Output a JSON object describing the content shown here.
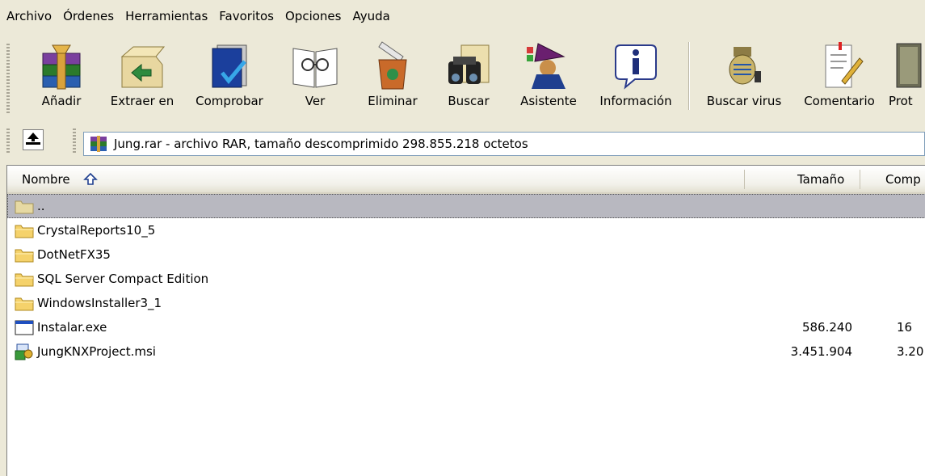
{
  "menu": [
    "Archivo",
    "Órdenes",
    "Herramientas",
    "Favoritos",
    "Opciones",
    "Ayuda"
  ],
  "toolbar": {
    "buttons": [
      {
        "label": "Añadir",
        "icon": "add-archive-icon"
      },
      {
        "label": "Extraer en",
        "icon": "extract-icon"
      },
      {
        "label": "Comprobar",
        "icon": "test-icon"
      },
      {
        "label": "Ver",
        "icon": "view-icon"
      },
      {
        "label": "Eliminar",
        "icon": "delete-icon"
      },
      {
        "label": "Buscar",
        "icon": "find-icon"
      },
      {
        "label": "Asistente",
        "icon": "wizard-icon"
      },
      {
        "label": "Información",
        "icon": "info-icon"
      },
      {
        "label": "Buscar virus",
        "icon": "virus-scan-icon"
      },
      {
        "label": "Comentario",
        "icon": "comment-icon"
      },
      {
        "label": "Prot",
        "icon": "protect-icon"
      }
    ]
  },
  "address": {
    "text": "Jung.rar - archivo RAR, tamaño descomprimido 298.855.218 octetos"
  },
  "columns": {
    "name": "Nombre",
    "size": "Tamaño",
    "packed": "Comp"
  },
  "files": [
    {
      "name": "..",
      "size": "",
      "packed": "",
      "type": "parent-folder",
      "selected": true
    },
    {
      "name": "CrystalReports10_5",
      "size": "",
      "packed": "",
      "type": "folder"
    },
    {
      "name": "DotNetFX35",
      "size": "",
      "packed": "",
      "type": "folder"
    },
    {
      "name": "SQL Server Compact Edition",
      "size": "",
      "packed": "",
      "type": "folder"
    },
    {
      "name": "WindowsInstaller3_1",
      "size": "",
      "packed": "",
      "type": "folder"
    },
    {
      "name": "Instalar.exe",
      "size": "586.240",
      "packed": "16",
      "type": "exe"
    },
    {
      "name": "JungKNXProject.msi",
      "size": "3.451.904",
      "packed": "3.20",
      "type": "msi"
    }
  ],
  "colors": {
    "window_bg": "#ece9d8",
    "selection": "#b8b8c0",
    "folder": "#f5d26b"
  }
}
